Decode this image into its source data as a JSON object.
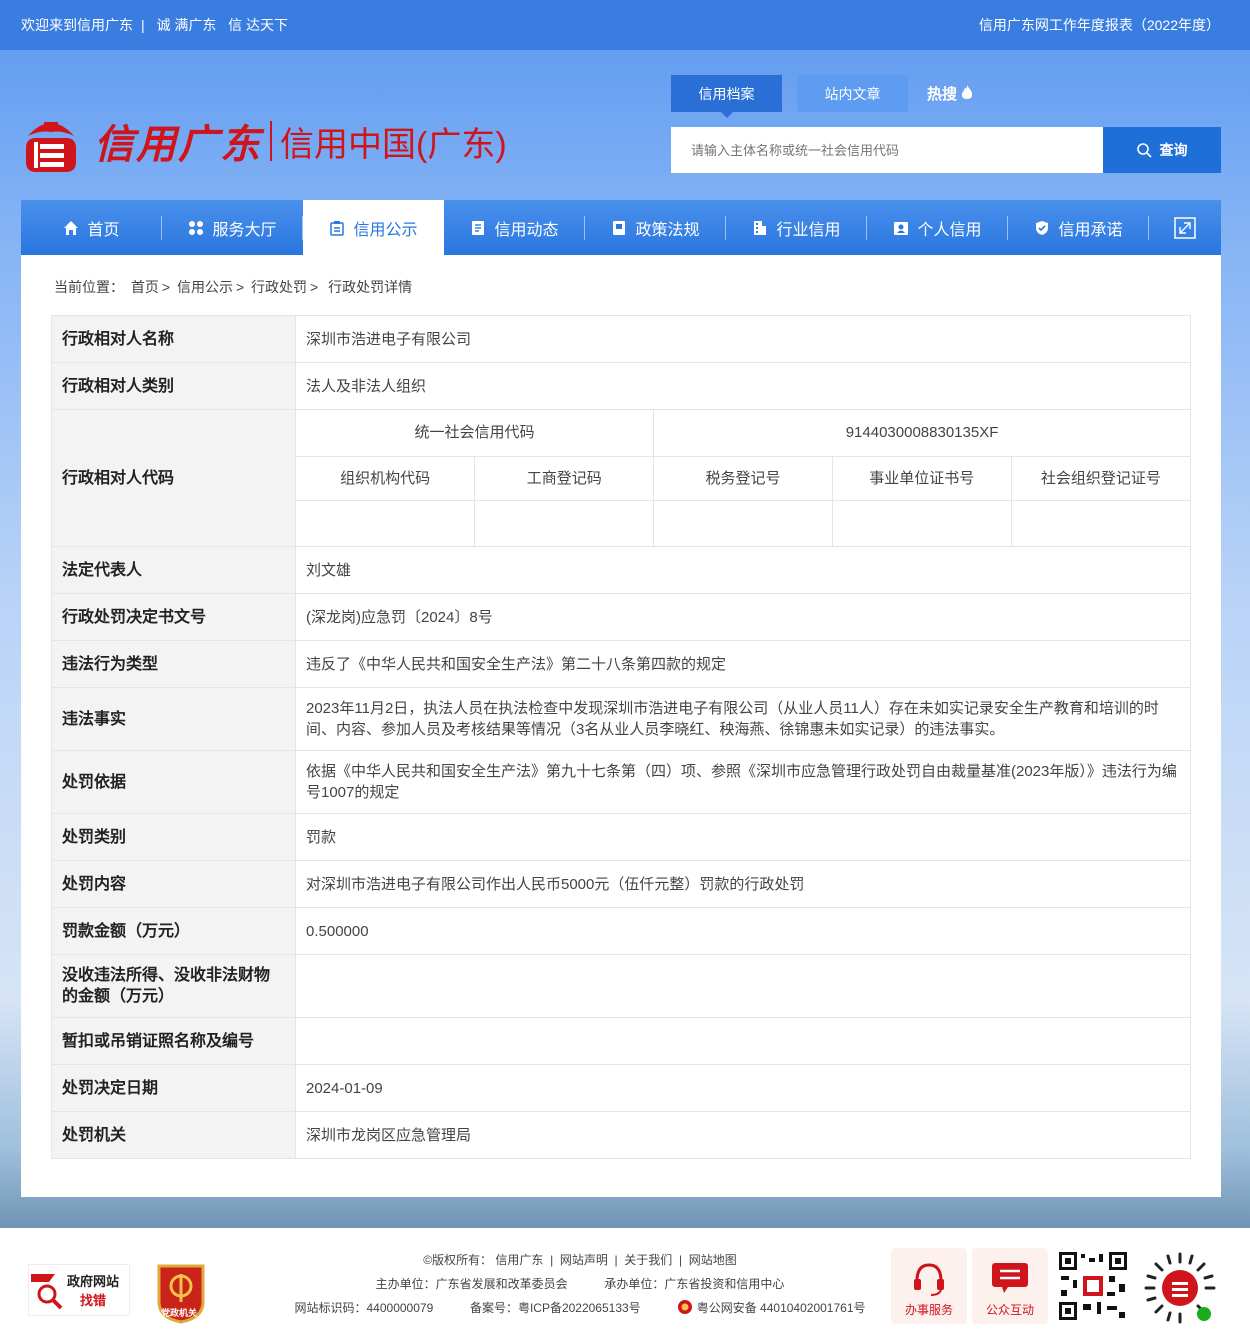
{
  "topbar": {
    "welcome": "欢迎来到信用广东",
    "slogan1": "诚 满广东",
    "slogan2": "信 达天下",
    "report": "信用广东网工作年度报表（2022年度）"
  },
  "logo": {
    "brand": "信用广东",
    "sub": "信用中国(广东)"
  },
  "search": {
    "tab_active": "信用档案",
    "tab2": "站内文章",
    "hot": "热搜",
    "placeholder": "请输入主体名称或统一社会信用代码",
    "button": "查询"
  },
  "nav": {
    "items": [
      "首页",
      "服务大厅",
      "信用公示",
      "信用动态",
      "政策法规",
      "行业信用",
      "个人信用",
      "信用承诺"
    ]
  },
  "breadcrumb": {
    "label": "当前位置：",
    "items": [
      "首页",
      "信用公示",
      "行政处罚",
      "行政处罚详情"
    ]
  },
  "detail": {
    "name_k": "行政相对人名称",
    "name_v": "深圳市浩进电子有限公司",
    "type_k": "行政相对人类别",
    "type_v": "法人及非法人组织",
    "code_k": "行政相对人代码",
    "uscc_label": "统一社会信用代码",
    "uscc_value": "9144030008830135XF",
    "sub_labels": [
      "组织机构代码",
      "工商登记码",
      "税务登记号",
      "事业单位证书号",
      "社会组织登记证号"
    ],
    "legal_k": "法定代表人",
    "legal_v": "刘文雄",
    "doc_k": "行政处罚决定书文号",
    "doc_v": "(深龙岗)应急罚〔2024〕8号",
    "vtype_k": "违法行为类型",
    "vtype_v": "违反了《中华人民共和国安全生产法》第二十八条第四款的规定",
    "fact_k": "违法事实",
    "fact_v": "2023年11月2日，执法人员在执法检查中发现深圳市浩进电子有限公司（从业人员11人）存在未如实记录安全生产教育和培训的时间、内容、参加人员及考核结果等情况（3名从业人员李晓红、秧海燕、徐锦惠未如实记录）的违法事实。",
    "basis_k": "处罚依据",
    "basis_v": "依据《中华人民共和国安全生产法》第九十七条第（四）项、参照《深圳市应急管理行政处罚自由裁量基准(2023年版）》违法行为编号1007的规定",
    "ptype_k": "处罚类别",
    "ptype_v": "罚款",
    "content_k": "处罚内容",
    "content_v": "对深圳市浩进电子有限公司作出人民币5000元（伍仟元整）罚款的行政处罚",
    "amount_k": "罚款金额（万元）",
    "amount_v": "0.500000",
    "confisc_k": "没收违法所得、没收非法财物的金额（万元）",
    "confisc_v": "",
    "license_k": "暂扣或吊销证照名称及编号",
    "license_v": "",
    "date_k": "处罚决定日期",
    "date_v": "2024-01-09",
    "org_k": "处罚机关",
    "org_v": "深圳市龙岗区应急管理局"
  },
  "footer": {
    "line1": "©版权所有： 信用广东  |  网站声明  |  关于我们  |  网站地图",
    "sponsor": "主办单位：广东省发展和改革委员会",
    "undertake": "承办单位：广东省投资和信用中心",
    "site_id": "网站标识码：4400000079",
    "icp": "备案号：粤ICP备2022065133号",
    "police": "粤公网安备 44010402001761号",
    "gov_badge_top": "政府网站",
    "gov_badge_bottom": "找错",
    "party_label": "党政机关",
    "service": "办事服务",
    "interact": "公众互动"
  }
}
